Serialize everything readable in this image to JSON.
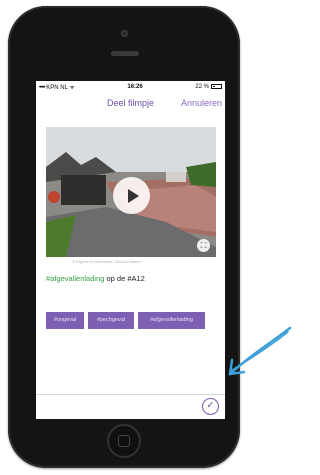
{
  "status_bar": {
    "carrier": "KPN NL",
    "time": "16:26",
    "battery": "22 %"
  },
  "nav": {
    "title": "Deel filmpje",
    "cancel": "Annuleren"
  },
  "video": {
    "location": "Ergens in Nederland, Noord-Holland"
  },
  "caption": {
    "hashtag": "#afgevallenlading",
    "rest": " op de #A12"
  },
  "tags": [
    "#ongeval",
    "#pechgeval",
    "#afgevallenlading"
  ],
  "colors": {
    "accent": "#7d5fb3",
    "hashtag": "#35a04a",
    "arrow": "#3d9fd8"
  },
  "icons": {
    "play": "play-icon",
    "crop": "crop-icon",
    "confirm": "checkmark-icon",
    "annotation": "arrow-annotation"
  }
}
